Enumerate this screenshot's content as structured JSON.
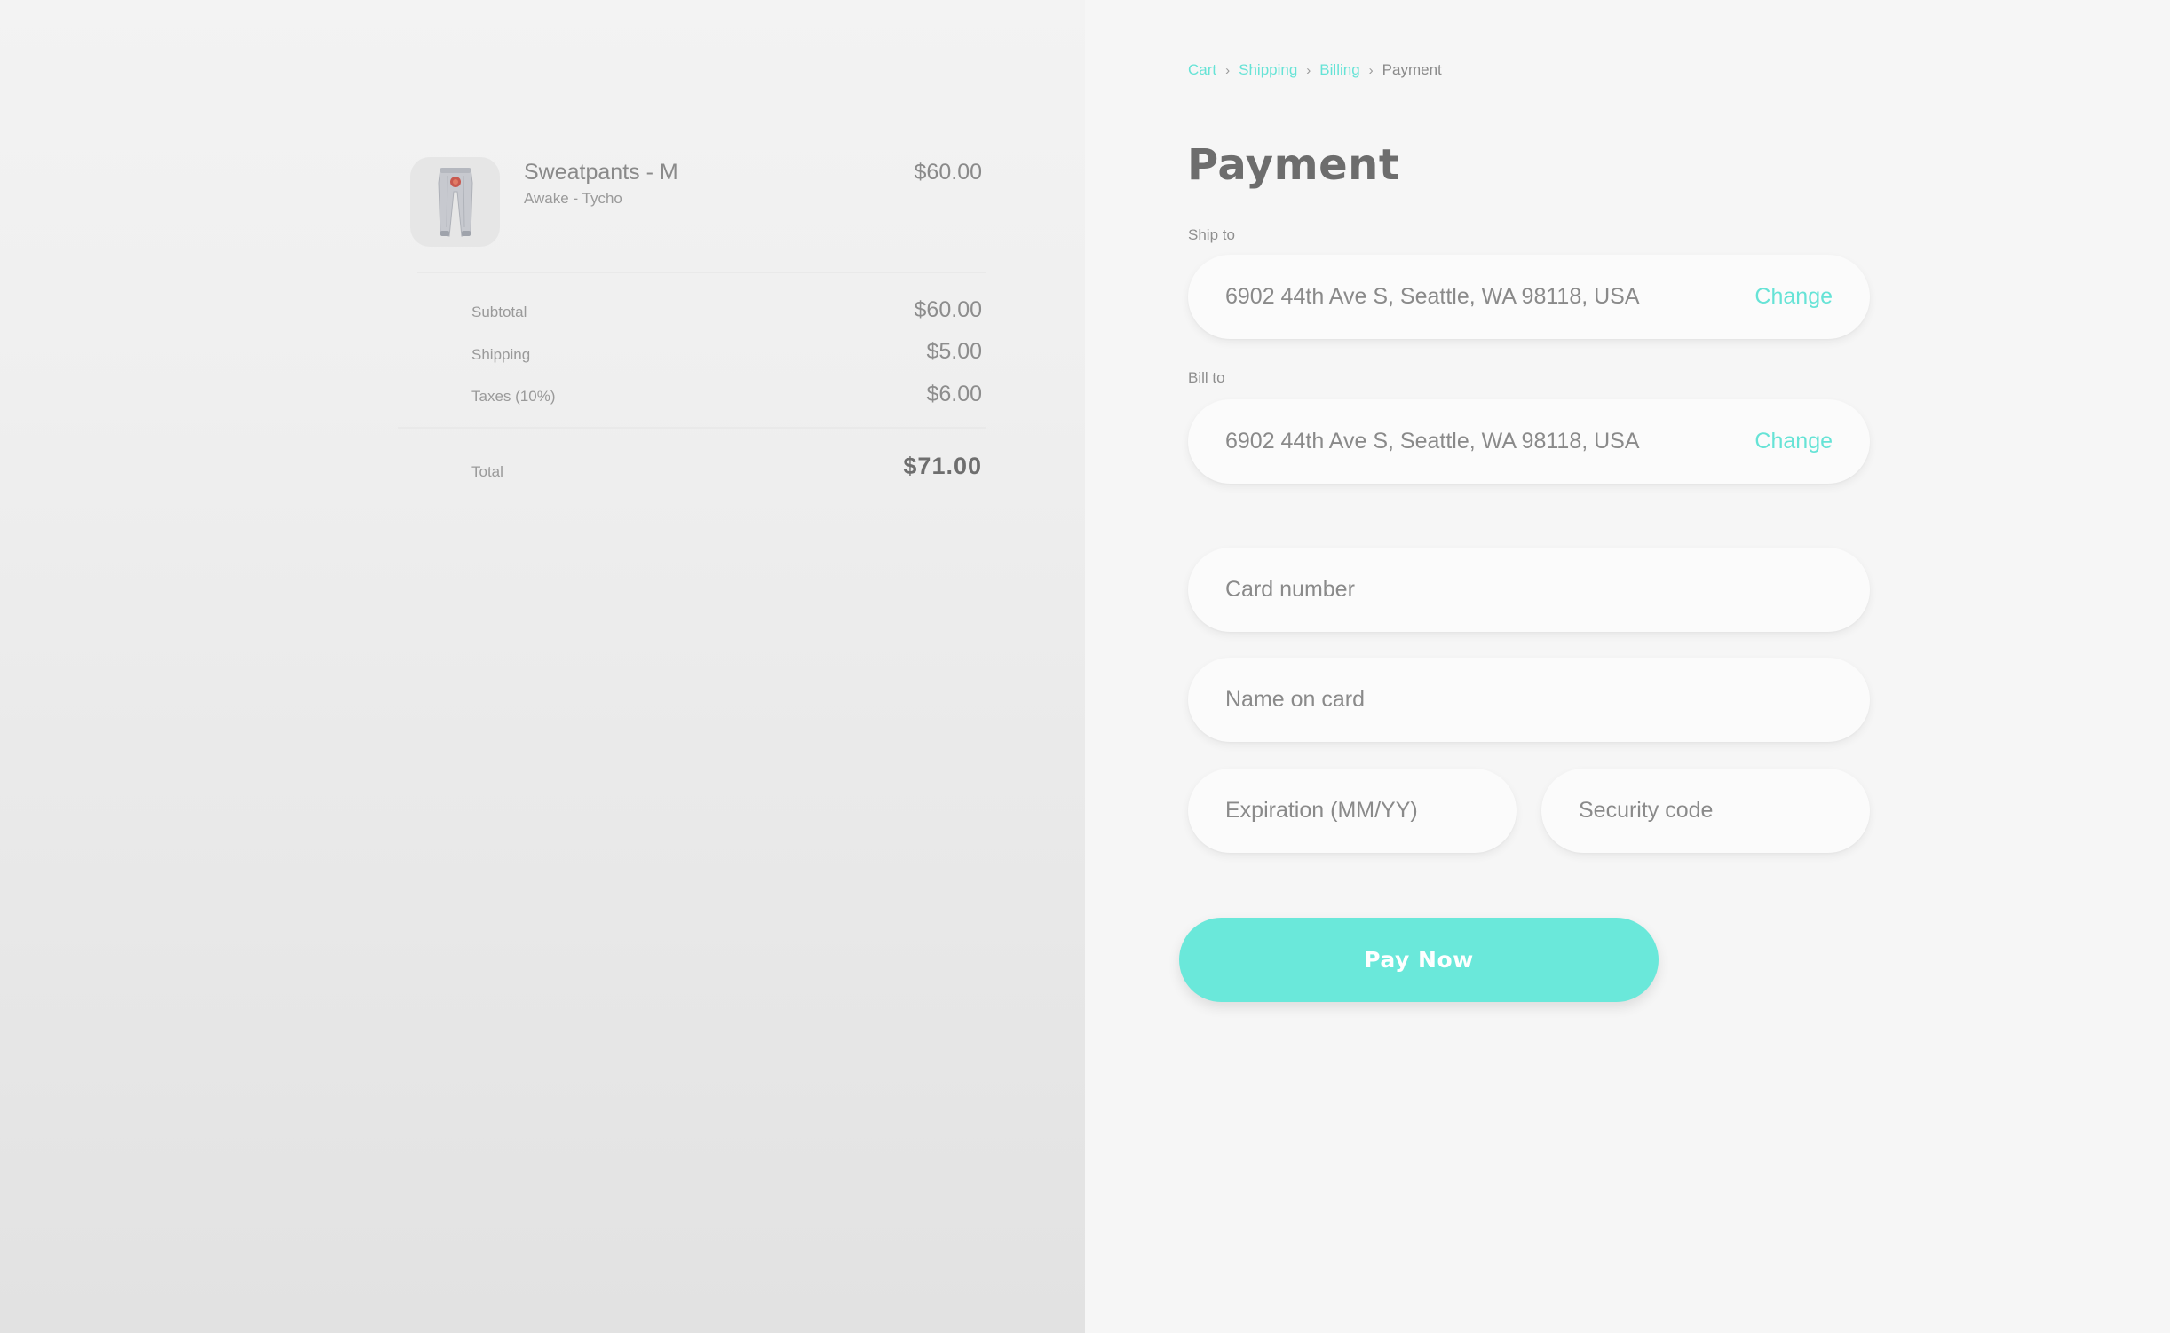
{
  "colors": {
    "accent": "#66e3d6",
    "button": "#6ae8da",
    "text": "#8a8a8a"
  },
  "order": {
    "product": {
      "image_icon": "sweatpants-image",
      "name": "Sweatpants - M",
      "subtitle": "Awake - Tycho",
      "price": "$60.00"
    },
    "lines": [
      {
        "label": "Subtotal",
        "value": "$60.00"
      },
      {
        "label": "Shipping",
        "value": "$5.00"
      },
      {
        "label": "Taxes (10%)",
        "value": "$6.00"
      }
    ],
    "total": {
      "label": "Total",
      "value": "$71.00"
    }
  },
  "breadcrumb": {
    "items": [
      "Cart",
      "Shipping",
      "Billing",
      "Payment"
    ],
    "separator": "›",
    "separator_icon": "chevron-right-icon"
  },
  "payment": {
    "title": "Payment",
    "ship_to": {
      "label": "Ship to",
      "address": "6902 44th Ave S, Seattle, WA 98118, USA",
      "change": "Change"
    },
    "bill_to": {
      "label": "Bill to",
      "address": "6902 44th Ave S, Seattle, WA 98118, USA",
      "change": "Change"
    },
    "fields": {
      "card_number": {
        "placeholder": "Card number",
        "value": ""
      },
      "name_on_card": {
        "placeholder": "Name on card",
        "value": ""
      },
      "expiration": {
        "placeholder": "Expiration (MM/YY)",
        "value": ""
      },
      "security_code": {
        "placeholder": "Security code",
        "value": ""
      }
    },
    "pay_button": "Pay Now"
  }
}
